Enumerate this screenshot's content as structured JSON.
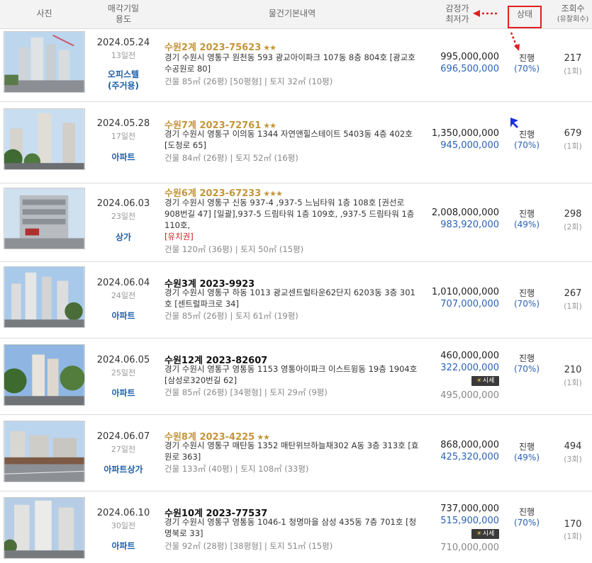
{
  "header": {
    "photo": "사진",
    "date_line1": "매각기일",
    "date_line2": "용도",
    "info": "물건기본내역",
    "price_line1": "감정가",
    "price_line2": "최저가",
    "status": "상태",
    "views_line1": "조회수",
    "views_line2": "(유찰회수)"
  },
  "market_badge": "시세",
  "items": [
    {
      "date": "2024.05.24",
      "days_left": "13일전",
      "type_line1": "오피스텔",
      "type_line2": "(주거용)",
      "case": "수원2계 2023-75623",
      "case_style": "gold",
      "stars": "★★",
      "address": "경기 수원시 영통구 원천동 593 광교아이파크 107동 8층 804호 [광교호수공원로 80]",
      "note": "",
      "area": "건물 85㎡ (26평) [50평형]  |  토지 32㎡ (10평)",
      "appraisal": "995,000,000",
      "min_price": "696,500,000",
      "market_price": "",
      "status": "진행",
      "percent": "(70%)",
      "views": "217",
      "fail_count": "(1회)"
    },
    {
      "date": "2024.05.28",
      "days_left": "17일전",
      "type_line1": "아파트",
      "type_line2": "",
      "case": "수원7계 2023-72761",
      "case_style": "gold",
      "stars": "★★",
      "address": "경기 수원시 영통구 이의동 1344 자연앤힐스테이트 5403동 4층 402호 [도청로 65]",
      "note": "",
      "area": "건물 84㎡ (26평)  |  토지 52㎡ (16평)",
      "appraisal": "1,350,000,000",
      "min_price": "945,000,000",
      "market_price": "",
      "status": "진행",
      "percent": "(70%)",
      "views": "679",
      "fail_count": "(1회)"
    },
    {
      "date": "2024.06.03",
      "days_left": "23일전",
      "type_line1": "상가",
      "type_line2": "",
      "case": "수원6계 2023-67233",
      "case_style": "gold",
      "stars": "★★★",
      "address": "경기 수원시 영통구 신동 937-4 ,937-5 느님타워 1층 108호 [권선로908번길 47] [일괄],937-5 드림타워 1층 109호, ,937-5 드림타워 1층 110호,",
      "note": "[유치권]",
      "area": "건물 120㎡ (36평)  |  토지 50㎡ (15평)",
      "appraisal": "2,008,000,000",
      "min_price": "983,920,000",
      "market_price": "",
      "status": "진행",
      "percent": "(49%)",
      "views": "298",
      "fail_count": "(2회)"
    },
    {
      "date": "2024.06.04",
      "days_left": "24일전",
      "type_line1": "아파트",
      "type_line2": "",
      "case": "수원3계 2023-9923",
      "case_style": "dark",
      "stars": "",
      "address": "경기 수원시 영통구 하동 1013 광교센트럴타운62단지 6203동 3층 301호 [센트럴파크로 34]",
      "note": "",
      "area": "건물 85㎡ (26평)  |  토지 61㎡ (19평)",
      "appraisal": "1,010,000,000",
      "min_price": "707,000,000",
      "market_price": "",
      "status": "진행",
      "percent": "(70%)",
      "views": "267",
      "fail_count": "(1회)"
    },
    {
      "date": "2024.06.05",
      "days_left": "25일전",
      "type_line1": "아파트",
      "type_line2": "",
      "case": "수원12계 2023-82607",
      "case_style": "dark",
      "stars": "",
      "address": "경기 수원시 영통구 영통동 1153 영통아이파크 이스트윙동 19층 1904호 [삼성로320번길 62]",
      "note": "",
      "area": "건물 85㎡ (26평) [34평형]  |  토지 29㎡ (9평)",
      "appraisal": "460,000,000",
      "min_price": "322,000,000",
      "market_price": "495,000,000",
      "status": "진행",
      "percent": "(70%)",
      "views": "210",
      "fail_count": "(1회)"
    },
    {
      "date": "2024.06.07",
      "days_left": "27일전",
      "type_line1": "아파트상가",
      "type_line2": "",
      "case": "수원8계 2023-4225",
      "case_style": "gold",
      "stars": "★★",
      "address": "경기 수원시 영통구 매탄동 1352 매탄위브하늘채302 A동 3층 313호 [효원로 363]",
      "note": "",
      "area": "건물 133㎡ (40평)  |  토지 108㎡ (33평)",
      "appraisal": "868,000,000",
      "min_price": "425,320,000",
      "market_price": "",
      "status": "진행",
      "percent": "(49%)",
      "views": "494",
      "fail_count": "(3회)"
    },
    {
      "date": "2024.06.10",
      "days_left": "30일전",
      "type_line1": "아파트",
      "type_line2": "",
      "case": "수원10계 2023-77537",
      "case_style": "dark",
      "stars": "",
      "address": "경기 수원시 영통구 영통동 1046-1 청명마을 삼성 435동 7층 701호 [청명북로 33]",
      "note": "",
      "area": "건물 92㎡ (28평) [38평형]  |  토지 51㎡ (15평)",
      "appraisal": "737,000,000",
      "min_price": "515,900,000",
      "market_price": "710,000,000",
      "status": "진행",
      "percent": "(70%)",
      "views": "170",
      "fail_count": "(1회)"
    }
  ],
  "colors": {
    "accent_blue": "#2a62b5",
    "gold": "#c4953a",
    "annotation_red": "#e02020"
  }
}
